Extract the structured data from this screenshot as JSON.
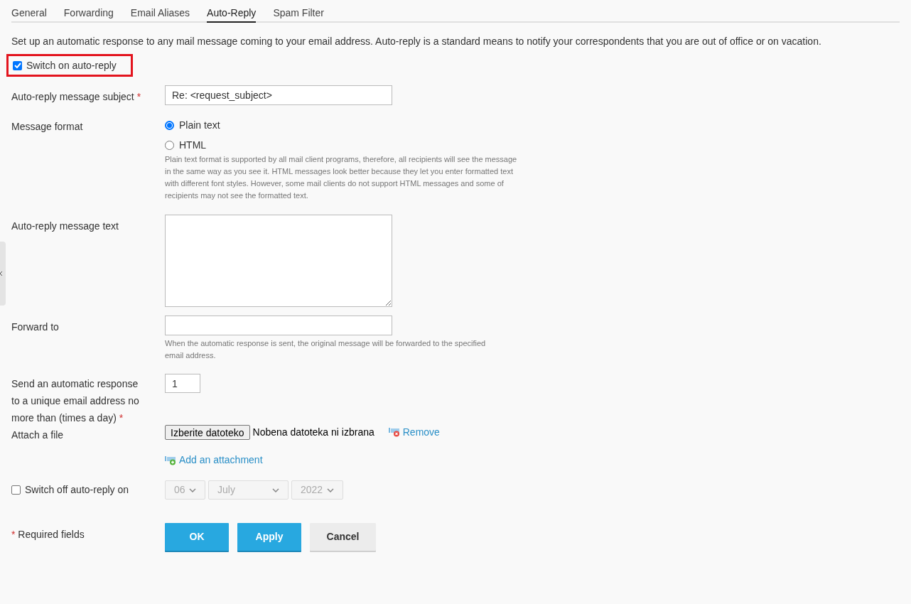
{
  "tabs": [
    {
      "label": "General",
      "selected": false
    },
    {
      "label": "Forwarding",
      "selected": false
    },
    {
      "label": "Email Aliases",
      "selected": false
    },
    {
      "label": "Auto-Reply",
      "selected": true
    },
    {
      "label": "Spam Filter",
      "selected": false
    }
  ],
  "description": "Set up an automatic response to any mail message coming to your email address. Auto-reply is a standard means to notify your correspondents that you are out of office or on vacation.",
  "switch_on": {
    "label": "Switch on auto-reply",
    "checked": true,
    "highlighted": true
  },
  "subject": {
    "label": "Auto-reply message subject",
    "required": true,
    "value": "Re: <request_subject>"
  },
  "message_format": {
    "label": "Message format",
    "options": [
      {
        "label": "Plain text",
        "selected": true
      },
      {
        "label": "HTML",
        "selected": false
      }
    ],
    "hint": "Plain text format is supported by all mail client programs, therefore, all recipients will see the message in the same way as you see it. HTML messages look better because they let you enter formatted text with different font styles. However, some mail clients do not support HTML messages and some of recipients may not see the formatted text."
  },
  "message_text": {
    "label": "Auto-reply message text"
  },
  "forward_to": {
    "label": "Forward to",
    "hint": "When the automatic response is sent, the original message will be forwarded to the specified email address."
  },
  "frequency": {
    "label": "Send an automatic response to a unique email address no more than (times a day)",
    "required": true,
    "value": "1"
  },
  "attach": {
    "label": "Attach a file",
    "choose_button": "Izberite datoteko",
    "status": "Nobena datoteka ni izbrana",
    "remove": "Remove",
    "add": "Add an attachment"
  },
  "switch_off": {
    "label": "Switch off auto-reply on",
    "checked": false,
    "day": "06",
    "month": "July",
    "year": "2022"
  },
  "required_note": {
    "mark": "*",
    "label": "Required fields"
  },
  "buttons": [
    {
      "label": "OK",
      "kind": "primary"
    },
    {
      "label": "Apply",
      "kind": "primary"
    },
    {
      "label": "Cancel",
      "kind": "secondary"
    }
  ]
}
